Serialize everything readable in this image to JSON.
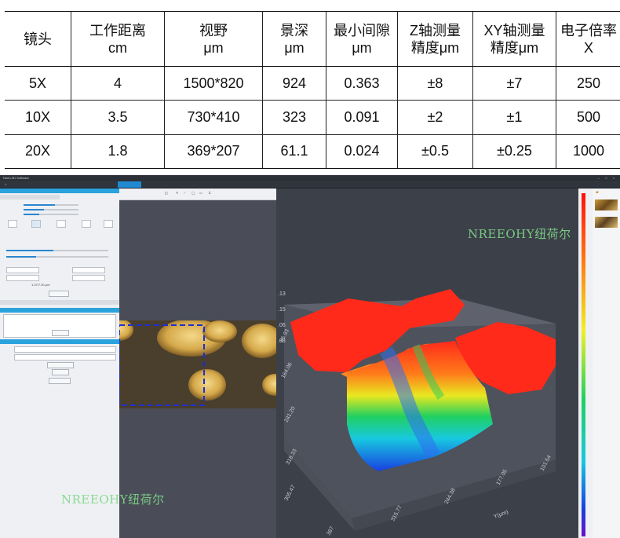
{
  "spec_table": {
    "headers": [
      {
        "line1": "镜头",
        "line2": ""
      },
      {
        "line1": "工作距离",
        "line2": "cm"
      },
      {
        "line1": "视野",
        "line2": "μm"
      },
      {
        "line1": "景深",
        "line2": "μm"
      },
      {
        "line1": "最小间隙",
        "line2": "μm"
      },
      {
        "line1": "Z轴测量",
        "line2": "精度μm"
      },
      {
        "line1": "XY轴测量",
        "line2": "精度μm"
      },
      {
        "line1": "电子倍率",
        "line2": "X"
      }
    ],
    "rows": [
      [
        "5X",
        "4",
        "1500*820",
        "924",
        "0.363",
        "±8",
        "±7",
        "250"
      ],
      [
        "10X",
        "3.5",
        "730*410",
        "323",
        "0.091",
        "±2",
        "±1",
        "500"
      ],
      [
        "20X",
        "1.8",
        "369*207",
        "61.1",
        "0.024",
        "±0.5",
        "±0.25",
        "1000"
      ]
    ]
  },
  "app": {
    "title": "Nireh-3D Software",
    "window_controls": "– □ ×",
    "tabs": [
      "",
      "",
      "",
      "",
      "",
      "",
      "",
      ""
    ],
    "active_tab_index": 5,
    "left_panel": {
      "section_title": "",
      "subtabs": [
        "",
        ""
      ],
      "band_1": "",
      "band_2": "",
      "band_3": "",
      "range_text": "1.07/7.00 μm",
      "file_label": "",
      "file_value": "",
      "path_value": "",
      "button_labels": [
        "",
        "",
        "",
        ""
      ]
    },
    "viewer_toolbar": [
      "",
      "",
      ""
    ],
    "axis_y_label": "Y(μm)",
    "x_ticks": [
      "",
      "",
      "",
      ""
    ],
    "y_ticks": [
      "315.77",
      "244.38",
      "177.05",
      "101.54"
    ],
    "z_ticks": [
      "387",
      "305.47",
      "318.33",
      "241.20",
      "164.06",
      "86.93"
    ],
    "side_ticks": [
      ".13",
      ".15",
      ".06",
      ".03"
    ]
  },
  "watermarks": {
    "top_right": "NREEOHY纽荷尔",
    "bottom_left": "NREEOHY纽荷尔"
  },
  "colors": {
    "accent": "#1f8ad2",
    "surface_high": "#ff2a1a",
    "surface_mid": "#20d060",
    "surface_low": "#1840e0",
    "watermark": "#7fd889"
  }
}
